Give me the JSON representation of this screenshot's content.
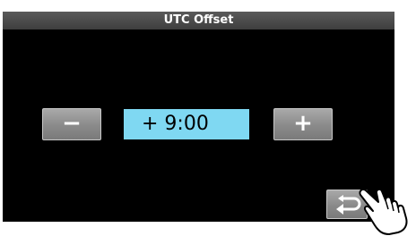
{
  "title": "UTC Offset",
  "buttons": {
    "minus": "−",
    "plus": "+"
  },
  "offset_value": "+  9:00",
  "icons": {
    "back": "return-icon",
    "pointer": "pointing-hand-icon"
  },
  "colors": {
    "value_bg": "#7fd8f2",
    "screen_bg": "#000000",
    "button": "#8e8e8e"
  }
}
